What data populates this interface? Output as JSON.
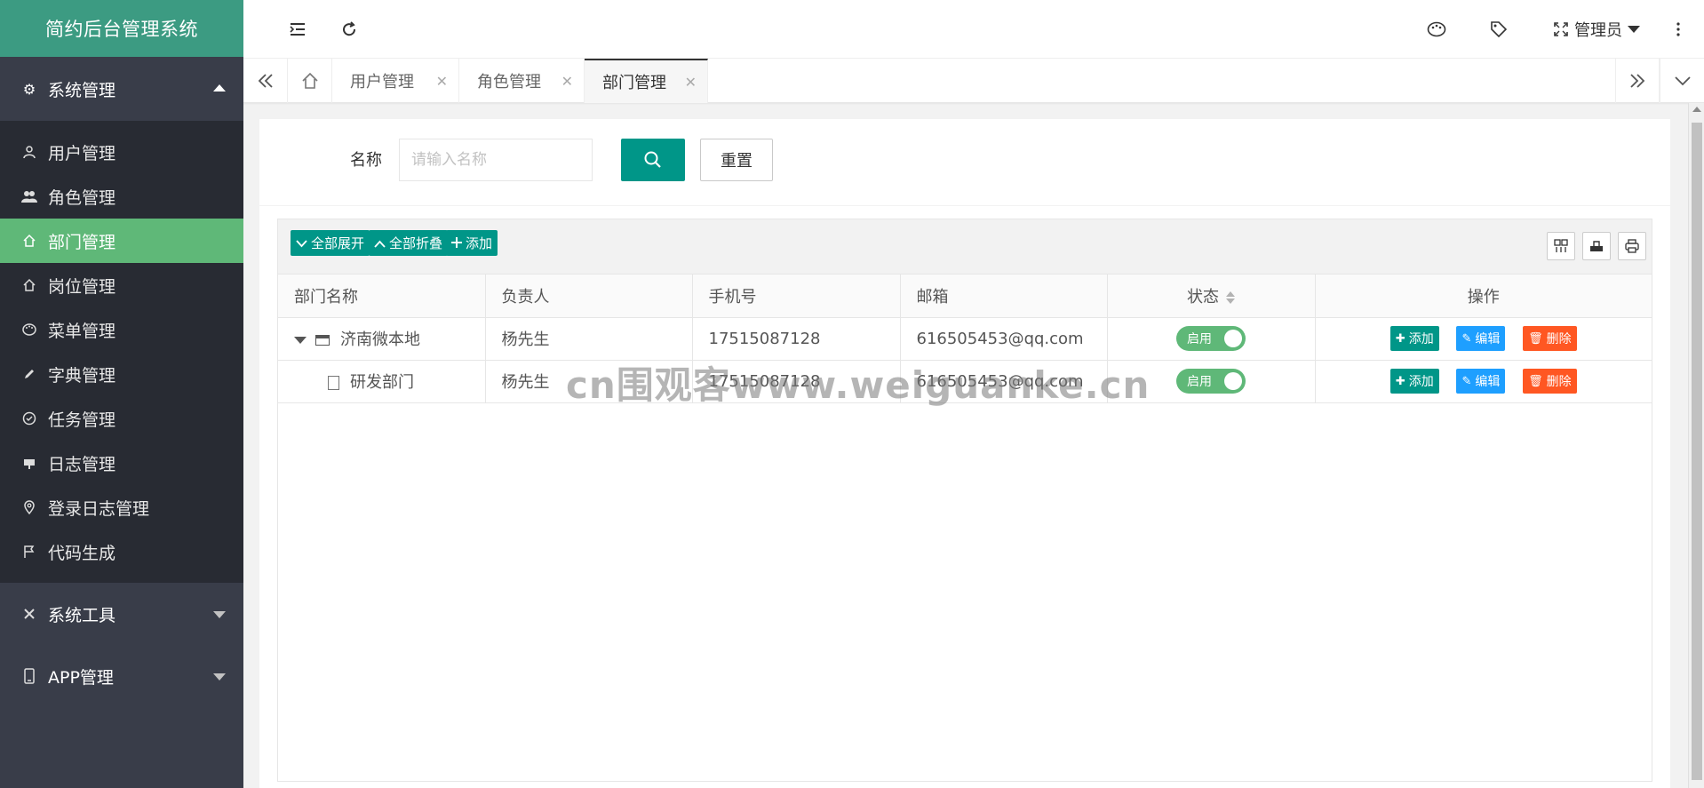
{
  "app": {
    "logo": "简约后台管理系统"
  },
  "sidebar": {
    "group_system": {
      "label": "系统管理"
    },
    "items": [
      {
        "label": "用户管理",
        "icon": "user-icon"
      },
      {
        "label": "角色管理",
        "icon": "users-icon"
      },
      {
        "label": "部门管理",
        "icon": "home-icon"
      },
      {
        "label": "岗位管理",
        "icon": "home-icon"
      },
      {
        "label": "菜单管理",
        "icon": "palette-icon"
      },
      {
        "label": "字典管理",
        "icon": "pencil-icon"
      },
      {
        "label": "任务管理",
        "icon": "check-circle-icon"
      },
      {
        "label": "日志管理",
        "icon": "log-icon"
      },
      {
        "label": "登录日志管理",
        "icon": "location-icon"
      },
      {
        "label": "代码生成",
        "icon": "flag-icon"
      }
    ],
    "group_tools": {
      "label": "系统工具"
    },
    "group_app": {
      "label": "APP管理"
    }
  },
  "header": {
    "user_label": "管理员"
  },
  "tabs": [
    {
      "label": "用户管理"
    },
    {
      "label": "角色管理"
    },
    {
      "label": "部门管理"
    }
  ],
  "search": {
    "label": "名称",
    "placeholder": "请输入名称",
    "reset_label": "重置"
  },
  "toolbar": {
    "expand_all": "全部展开",
    "collapse_all": "全部折叠",
    "add": "添加"
  },
  "table": {
    "headers": [
      "部门名称",
      "负责人",
      "手机号",
      "邮箱",
      "状态",
      "操作"
    ],
    "rows": [
      {
        "name": "济南微本地",
        "leader": "杨先生",
        "phone": "17515087128",
        "email": "616505453@qq.com",
        "status": "启用"
      },
      {
        "name": "研发部门",
        "leader": "杨先生",
        "phone": "17515087128",
        "email": "616505453@qq.com",
        "status": "启用"
      }
    ],
    "actions": {
      "add": "添加",
      "edit": "编辑",
      "delete": "删除"
    }
  },
  "watermark": "cn围观客www.weiguanke.cn",
  "colors": {
    "primary": "#009688",
    "active_menu": "#5fb878",
    "sidebar": "#393d49",
    "logo_bg": "#3c9b82",
    "edit": "#1e9fff",
    "delete": "#ff5722"
  }
}
